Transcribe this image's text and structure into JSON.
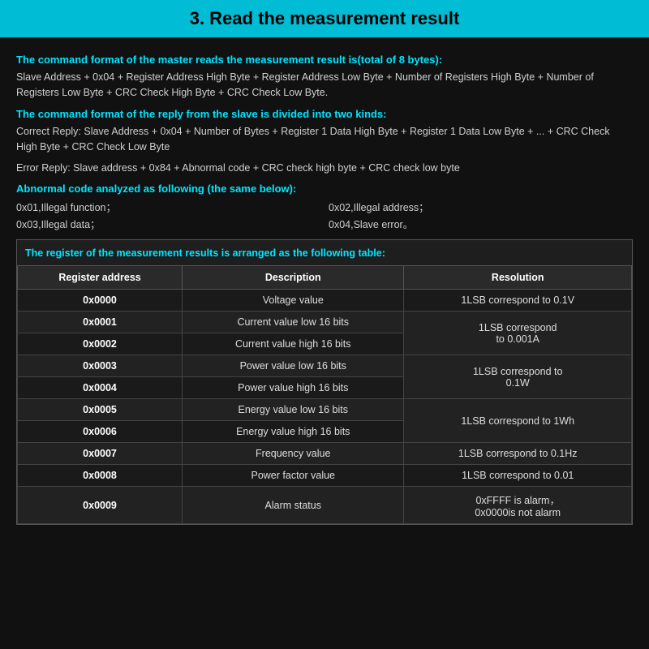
{
  "title": "3. Read the measurement result",
  "sections": {
    "master_format_header": "The command format of the master reads the measurement result is(total of 8 bytes):",
    "master_format_text": "Slave Address + 0x04 + Register Address High Byte + Register Address Low Byte + Number of Registers High Byte + Number of Registers Low Byte + CRC Check High Byte + CRC Check Low Byte.",
    "reply_format_header": "The command format of the reply from the slave is divided into two kinds:",
    "correct_reply_text": "Correct Reply: Slave Address + 0x04 + Number of Bytes + Register 1 Data High Byte + Register 1 Data Low Byte + ... + CRC Check High Byte + CRC Check Low Byte",
    "error_reply_text": "Error Reply: Slave address + 0x84 + Abnormal code + CRC check high byte + CRC check low byte",
    "abnormal_header": "Abnormal code analyzed as following (the same below):",
    "abnormal_codes": [
      [
        "0x01,Illegal function；",
        "0x02,Illegal address；"
      ],
      [
        "0x03,Illegal data；",
        "0x04,Slave error。"
      ]
    ],
    "table_intro": "The register of the measurement results is arranged as the following table:"
  },
  "table": {
    "headers": [
      "Register address",
      "Description",
      "Resolution"
    ],
    "rows": [
      [
        "0x0000",
        "Voltage value",
        "1LSB correspond to 0.1V"
      ],
      [
        "0x0001",
        "Current value low 16 bits",
        "1LSB correspond\nto 0.001A"
      ],
      [
        "0x0002",
        "Current value high 16 bits",
        ""
      ],
      [
        "0x0003",
        "Power value low 16 bits",
        "1LSB correspond to\n0.1W"
      ],
      [
        "0x0004",
        "Power value high 16 bits",
        ""
      ],
      [
        "0x0005",
        "Energy value low 16 bits",
        "1LSB correspond to 1Wh"
      ],
      [
        "0x0006",
        "Energy value high 16 bits",
        ""
      ],
      [
        "0x0007",
        "Frequency value",
        "1LSB correspond to 0.1Hz"
      ],
      [
        "0x0008",
        "Power factor value",
        "1LSB correspond to 0.01"
      ],
      [
        "0x0009",
        "Alarm status",
        "0xFFFF is alarm，\n0x0000is not alarm"
      ]
    ]
  }
}
